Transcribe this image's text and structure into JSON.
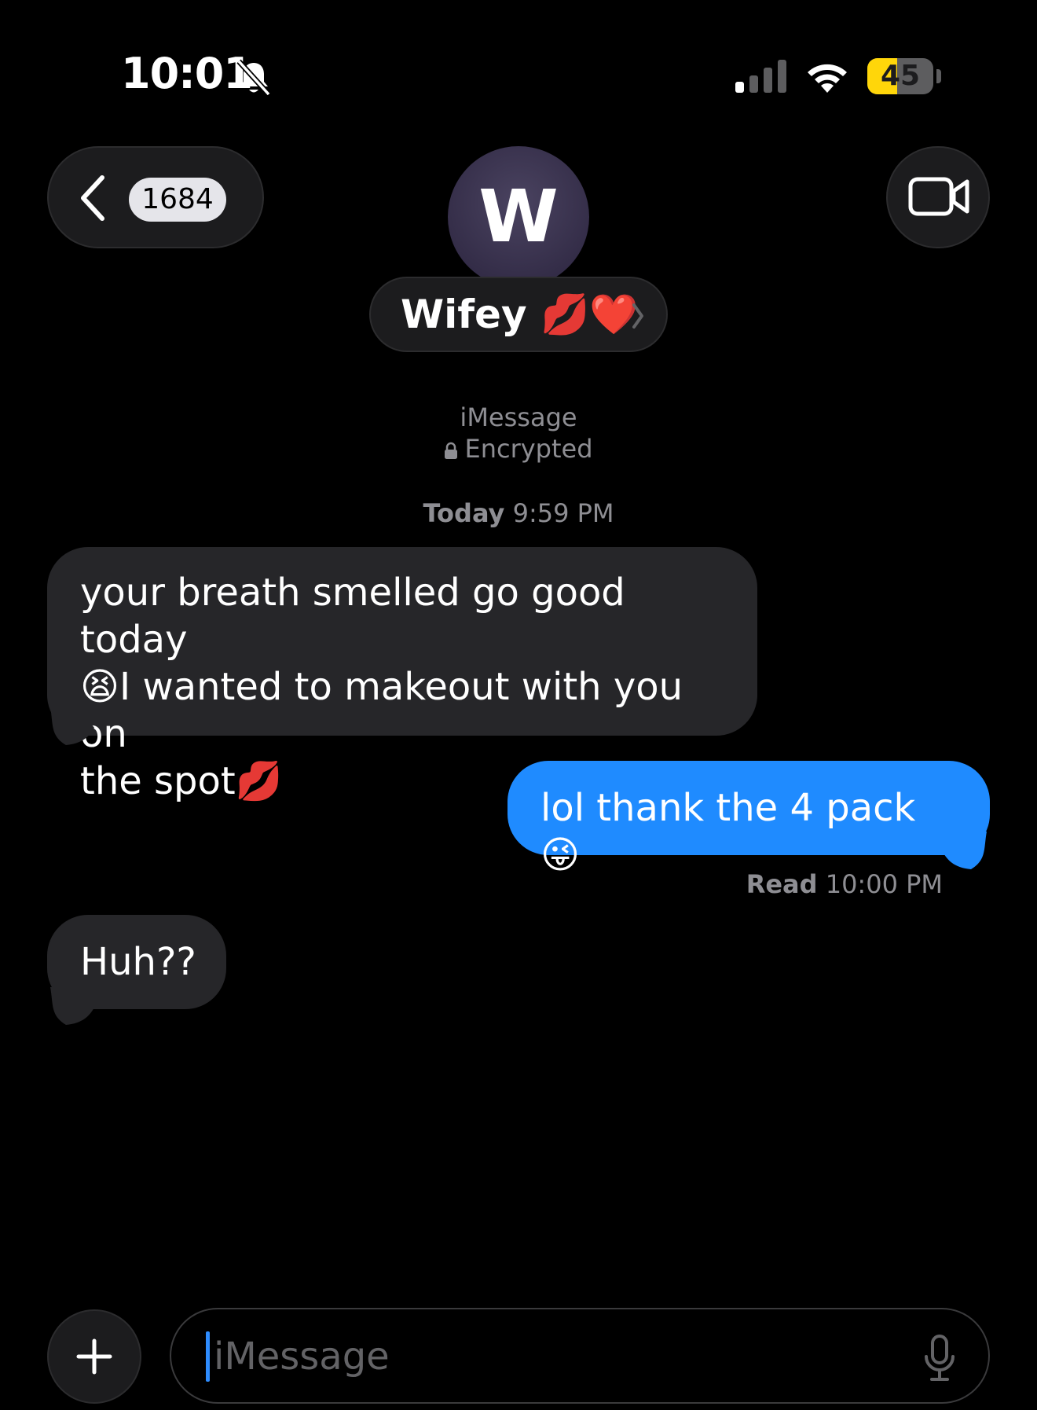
{
  "status_bar": {
    "time": "10:01",
    "battery_level": "45",
    "battery_fraction": 0.45,
    "icons": [
      "bell-slash-icon",
      "cellular-signal-icon",
      "wifi-icon",
      "battery-icon"
    ]
  },
  "nav": {
    "back_icon": "chevron-left-icon",
    "unread_count": "1684",
    "video_icon": "video-camera-icon"
  },
  "contact": {
    "initial": "W",
    "name": "Wifey 💋❤️",
    "chevron_icon": "chevron-right-icon"
  },
  "conversation": {
    "service": "iMessage",
    "encryption": "Encrypted",
    "timestamp_day": "Today",
    "timestamp_time": "9:59 PM",
    "messages": [
      {
        "direction": "incoming",
        "text": "your breath smelled go good today\n😫I wanted to makeout with you on\nthe spot💋"
      },
      {
        "direction": "outgoing",
        "text": "lol thank the 4 pack 😜"
      },
      {
        "direction": "incoming",
        "text": "Huh??"
      }
    ],
    "read_label": "Read",
    "read_time": "10:00 PM"
  },
  "composer": {
    "plus_icon": "plus-icon",
    "placeholder": "iMessage",
    "mic_icon": "microphone-icon"
  },
  "colors": {
    "background": "#000000",
    "incoming_bubble": "#262629",
    "outgoing_bubble": "#1f8bff",
    "secondary_text": "#8e8e93",
    "battery": "#ffd60a"
  }
}
